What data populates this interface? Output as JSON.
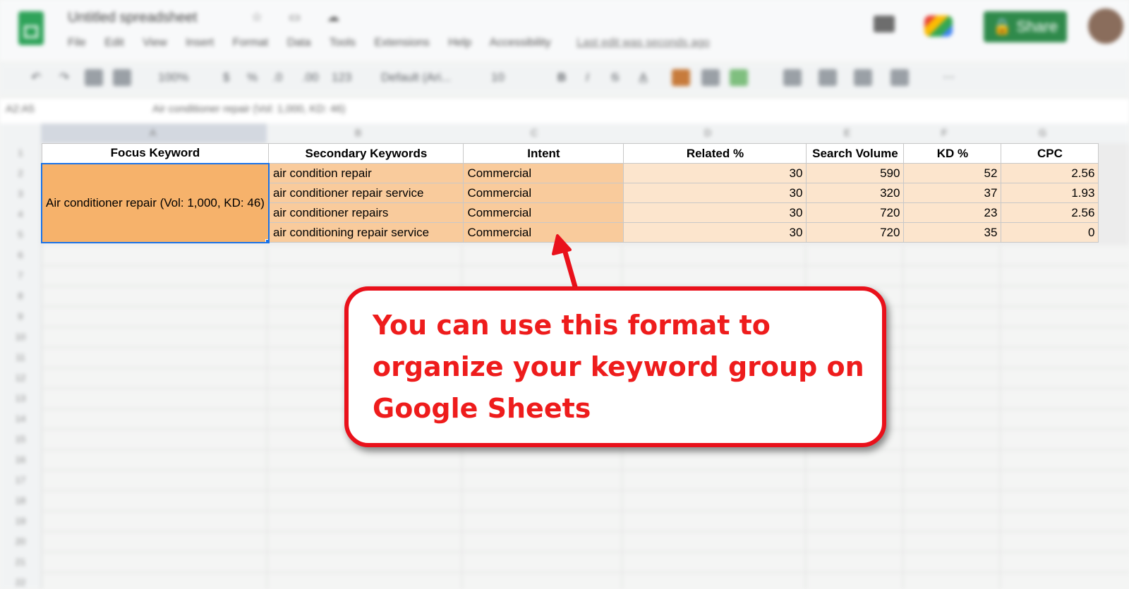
{
  "app": {
    "doc_title": "Untitled spreadsheet",
    "menu": [
      "File",
      "Edit",
      "View",
      "Insert",
      "Format",
      "Data",
      "Tools",
      "Extensions",
      "Help",
      "Accessibility"
    ],
    "last_edit": "Last edit was seconds ago",
    "share_label": "Share",
    "zoom": "100%",
    "font_name": "Default (Ari...",
    "font_size": "10",
    "name_box": "A2:A5",
    "formula": "Air conditioner repair (Vol: 1,000, KD: 46)",
    "column_letters": [
      "A",
      "B",
      "C",
      "D",
      "E",
      "F",
      "G"
    ],
    "row_numbers": [
      "1",
      "2",
      "3",
      "4",
      "5",
      "6",
      "7",
      "8",
      "9",
      "10",
      "11",
      "12",
      "13",
      "14",
      "15",
      "16",
      "17",
      "18",
      "19",
      "20",
      "21",
      "22"
    ]
  },
  "sheet": {
    "headers": [
      "Focus Keyword",
      "Secondary Keywords",
      "Intent",
      "Related %",
      "Search Volume",
      "KD %",
      "CPC"
    ],
    "focus_keyword": "Air conditioner repair (Vol: 1,000, KD: 46)",
    "rows": [
      {
        "secondary": "air condition repair",
        "intent": "Commercial",
        "related": "30",
        "volume": "590",
        "kd": "52",
        "cpc": "2.56"
      },
      {
        "secondary": "air conditioner repair service",
        "intent": "Commercial",
        "related": "30",
        "volume": "320",
        "kd": "37",
        "cpc": "1.93"
      },
      {
        "secondary": "air conditioner repairs",
        "intent": "Commercial",
        "related": "30",
        "volume": "720",
        "kd": "23",
        "cpc": "2.56"
      },
      {
        "secondary": "air conditioning repair service",
        "intent": "Commercial",
        "related": "30",
        "volume": "720",
        "kd": "35",
        "cpc": "0"
      }
    ]
  },
  "callout": {
    "text": "You can use this format to organize your keyword group on Google Sheets"
  },
  "colors": {
    "focus_fill": "#f6b26b",
    "secondary_fill": "#f9cb9c",
    "metrics_fill": "#fce5cd",
    "callout_red": "#e9111b",
    "share_green": "#2f8a4b"
  }
}
